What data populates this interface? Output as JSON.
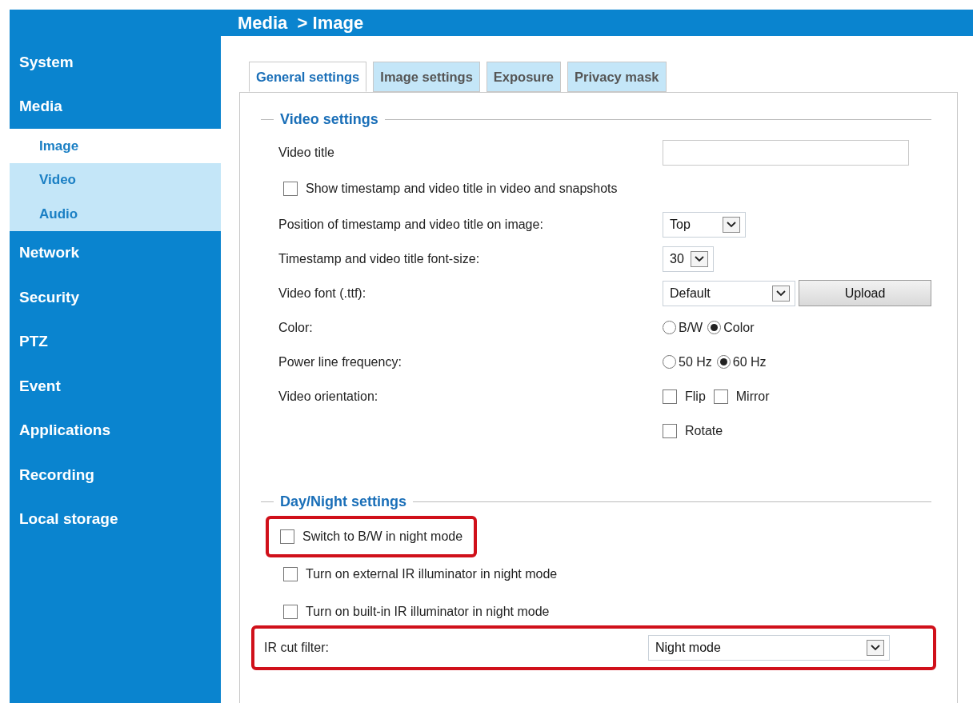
{
  "header": {
    "title": "Media  > Image"
  },
  "sidebar": {
    "items": [
      {
        "label": "System",
        "selected": false
      },
      {
        "label": "Media",
        "selected": false,
        "children": [
          {
            "label": "Image",
            "selected": true
          },
          {
            "label": "Video",
            "selected": false
          },
          {
            "label": "Audio",
            "selected": false
          }
        ]
      },
      {
        "label": "Network",
        "selected": false
      },
      {
        "label": "Security",
        "selected": false
      },
      {
        "label": "PTZ",
        "selected": false
      },
      {
        "label": "Event",
        "selected": false
      },
      {
        "label": "Applications",
        "selected": false
      },
      {
        "label": "Recording",
        "selected": false
      },
      {
        "label": "Local storage",
        "selected": false
      }
    ]
  },
  "tabs": [
    {
      "label": "General settings",
      "selected": true
    },
    {
      "label": "Image settings",
      "selected": false
    },
    {
      "label": "Exposure",
      "selected": false
    },
    {
      "label": "Privacy mask",
      "selected": false
    }
  ],
  "sections": [
    {
      "title": "Video settings",
      "rows": [
        {
          "kind": "text",
          "label": "Video title",
          "highlighted": false
        },
        {
          "kind": "checkbox",
          "label": "Show timestamp and video title in video and snapshots",
          "checked": false,
          "highlighted": false
        },
        {
          "kind": "select",
          "label": "Position of timestamp and video title on image:",
          "value": "Top",
          "highlighted": false
        },
        {
          "kind": "select",
          "label": "Timestamp and video title font-size:",
          "value": "30",
          "highlighted": false
        },
        {
          "kind": "select",
          "label": "Video font (.ttf):",
          "value": "Default",
          "button": "Upload",
          "highlighted": false
        },
        {
          "kind": "radio",
          "label": "Color:",
          "options": [
            {
              "label": "B/W",
              "selected": false
            },
            {
              "label": "Color",
              "selected": true
            }
          ],
          "highlighted": false
        },
        {
          "kind": "radio",
          "label": "Power line frequency:",
          "options": [
            {
              "label": "50 Hz",
              "selected": false
            },
            {
              "label": "60 Hz",
              "selected": true
            }
          ],
          "highlighted": false
        },
        {
          "kind": "checks",
          "label": "Video orientation:",
          "options": [
            {
              "label": "Flip",
              "checked": false
            },
            {
              "label": "Mirror",
              "checked": false
            }
          ],
          "highlighted": false
        },
        {
          "kind": "checks",
          "options": [
            {
              "label": "Rotate",
              "checked": false
            }
          ],
          "highlighted": false
        }
      ]
    },
    {
      "title": "Day/Night settings",
      "rows": [
        {
          "kind": "checkbox",
          "label": "Switch to B/W in night mode",
          "checked": false,
          "highlighted": true
        },
        {
          "kind": "checkbox",
          "label": "Turn on external IR illuminator in night mode",
          "checked": false,
          "highlighted": false
        },
        {
          "kind": "checkbox",
          "label": "Turn on built-in IR illuminator in night mode",
          "checked": false,
          "highlighted": false
        },
        {
          "kind": "select",
          "label": "IR cut filter:",
          "value": "Night mode",
          "highlighted": true
        }
      ]
    }
  ]
}
